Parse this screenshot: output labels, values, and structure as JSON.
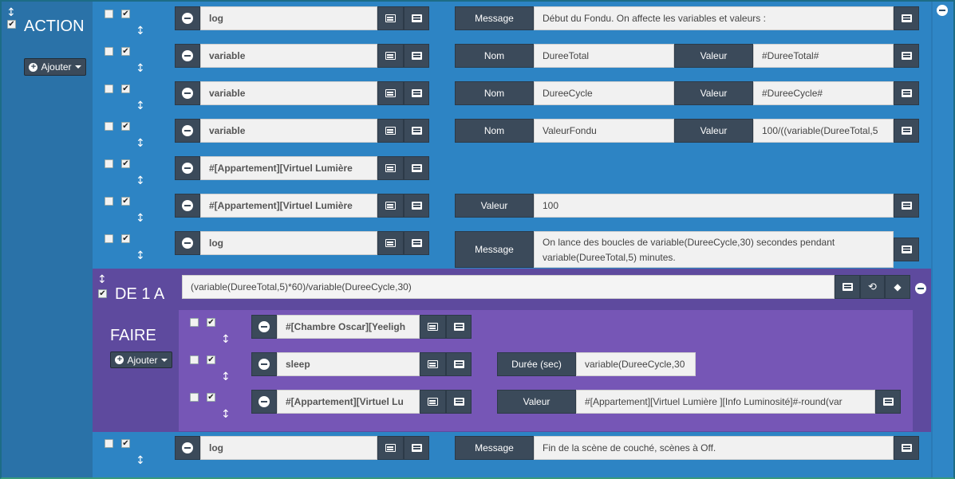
{
  "action": {
    "title": "ACTION",
    "add_button": "Ajouter",
    "rows": [
      {
        "cmd": "log",
        "label": "Message",
        "value": "Début du Fondu. On affecte les variables et valeurs :"
      },
      {
        "cmd": "variable",
        "name_label": "Nom",
        "name_value": "DureeTotal",
        "val_label": "Valeur",
        "val_value": "#DureeTotal#"
      },
      {
        "cmd": "variable",
        "name_label": "Nom",
        "name_value": "DureeCycle",
        "val_label": "Valeur",
        "val_value": "#DureeCycle#"
      },
      {
        "cmd": "variable",
        "name_label": "Nom",
        "name_value": "ValeurFondu",
        "val_label": "Valeur",
        "val_value": "100/((variable(DureeTotal,5"
      },
      {
        "cmd": "#[Appartement][Virtuel Lumière "
      },
      {
        "cmd": "#[Appartement][Virtuel Lumière ",
        "label": "Valeur",
        "value": "100"
      },
      {
        "cmd": "log",
        "label": "Message",
        "value": "On lance des boucles de variable(DureeCycle,30) secondes pendant variable(DureeTotal,5) minutes."
      },
      {
        "cmd": "log",
        "label": "Message",
        "value": "Fin de la scène de couché, scènes à Off."
      }
    ]
  },
  "loop": {
    "title": "DE 1 A",
    "expression": "(variable(DureeTotal,5)*60)/variable(DureeCycle,30)",
    "faire_title": "FAIRE",
    "add_button": "Ajouter",
    "rows": [
      {
        "cmd": "#[Chambre Oscar][Yeeligh"
      },
      {
        "cmd": "sleep",
        "label": "Durée (sec)",
        "value": "variable(DureeCycle,30"
      },
      {
        "cmd": "#[Appartement][Virtuel Lu",
        "label": "Valeur",
        "value": "#[Appartement][Virtuel Lumière ][Info Luminosité]#-round(var"
      }
    ]
  },
  "checkbox_checked": "✔",
  "move_icon": "↕",
  "colors": {
    "blue": "#2d84c4",
    "purple": "#5e4a9e",
    "purple_inner": "#7656b6",
    "dark": "#3b4a5a"
  }
}
